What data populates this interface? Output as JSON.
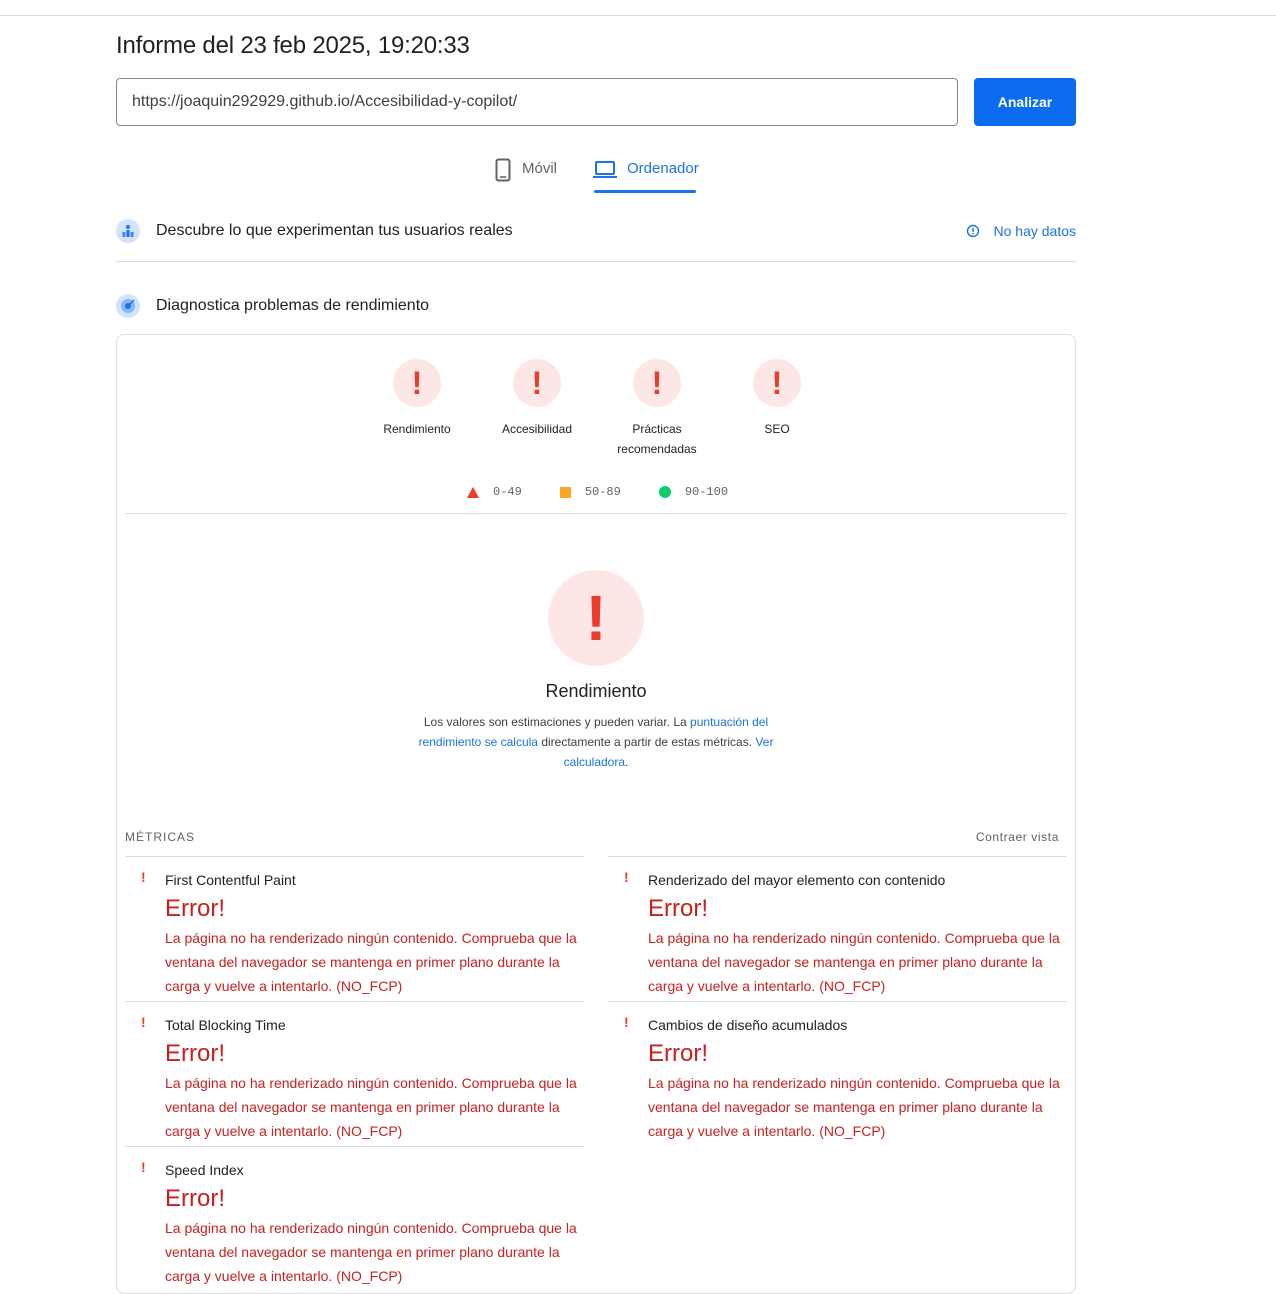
{
  "report": {
    "title": "Informe del 23 feb 2025, 19:20:33"
  },
  "search": {
    "url": "https://joaquin292929.github.io/Accesibilidad-y-copilot/",
    "button": "Analizar"
  },
  "tabs": [
    {
      "label": "Móvil",
      "icon": "smartphone-icon",
      "active": false
    },
    {
      "label": "Ordenador",
      "icon": "laptop-icon",
      "active": true
    }
  ],
  "field_data": {
    "title": "Descubre lo que experimentan tus usuarios reales",
    "status": "No hay datos"
  },
  "lab_data": {
    "title": "Diagnostica problemas de rendimiento"
  },
  "gauges": [
    {
      "label": "Rendimiento",
      "symbol": "!"
    },
    {
      "label": "Accesibilidad",
      "symbol": "!"
    },
    {
      "label": "Prácticas recomendadas",
      "symbol": "!"
    },
    {
      "label": "SEO",
      "symbol": "!"
    }
  ],
  "legend": [
    {
      "range": "0-49",
      "color": "#eb3b2b"
    },
    {
      "range": "50-89",
      "color": "#fca527"
    },
    {
      "range": "90-100",
      "color": "#0cce6b"
    }
  ],
  "performance": {
    "title": "Rendimiento",
    "desc_1": "Los valores son estimaciones y pueden variar. La",
    "link_1": "puntuación del rendimiento se calcula",
    "desc_2": "directamente a partir de estas métricas.",
    "link_2": "Ver calculadora",
    "desc_3": "."
  },
  "metrics": {
    "label": "MÉTRICAS",
    "collapse": "Contraer vista",
    "items": [
      {
        "name": "First Contentful Paint",
        "error": "Error!",
        "message": "La página no ha renderizado ningún contenido. Comprueba que la ventana del navegador se mantenga en primer plano durante la carga y vuelve a intentarlo. (NO_FCP)"
      },
      {
        "name": "Renderizado del mayor elemento con contenido",
        "error": "Error!",
        "message": "La página no ha renderizado ningún contenido. Comprueba que la ventana del navegador se mantenga en primer plano durante la carga y vuelve a intentarlo. (NO_FCP)"
      },
      {
        "name": "Total Blocking Time",
        "error": "Error!",
        "message": "La página no ha renderizado ningún contenido. Comprueba que la ventana del navegador se mantenga en primer plano durante la carga y vuelve a intentarlo. (NO_FCP)"
      },
      {
        "name": "Cambios de diseño acumulados",
        "error": "Error!",
        "message": "La página no ha renderizado ningún contenido. Comprueba que la ventana del navegador se mantenga en primer plano durante la carga y vuelve a intentarlo. (NO_FCP)"
      },
      {
        "name": "Speed Index",
        "error": "Error!",
        "message": "La página no ha renderizado ningún contenido. Comprueba que la ventana del navegador se mantenga en primer plano durante la carga y vuelve a intentarlo. (NO_FCP)"
      }
    ]
  },
  "colors": {
    "accent": "#1a73e8",
    "button": "#0b6cf0",
    "fail": "#eb3b2b",
    "fail_bg": "#fde7e6",
    "error_text": "#c5221f"
  }
}
